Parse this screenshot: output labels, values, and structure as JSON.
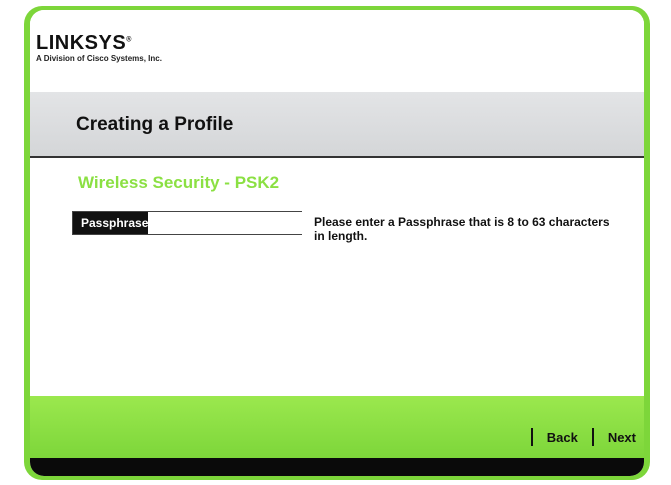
{
  "brand": {
    "name": "LINKSYS",
    "registered": "®",
    "tagline": "A Division of Cisco Systems, Inc."
  },
  "header": {
    "title": "Creating a Profile"
  },
  "section": {
    "title": "Wireless Security - PSK2"
  },
  "form": {
    "passphrase_label": "Passphrase",
    "passphrase_value": "",
    "help_text": "Please enter a Passphrase that is 8 to 63 characters in length."
  },
  "nav": {
    "back_label": "Back",
    "next_label": "Next"
  },
  "colors": {
    "accent_green": "#7dd63a",
    "title_green": "#8be043",
    "band_gray": "#d9dadc",
    "footer_black": "#0a0a0a"
  }
}
